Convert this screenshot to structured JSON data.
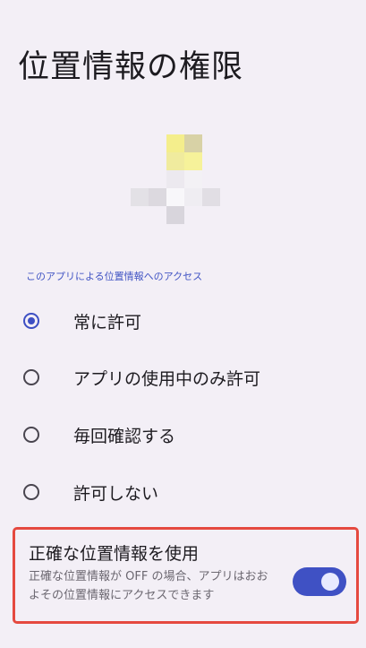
{
  "header": {
    "title": "位置情報の権限"
  },
  "app_icon": {
    "name": "app-icon-blurred"
  },
  "section": {
    "header": "このアプリによる位置情報へのアクセス"
  },
  "options": [
    {
      "label": "常に許可",
      "checked": true
    },
    {
      "label": "アプリの使用中のみ許可",
      "checked": false
    },
    {
      "label": "毎回確認する",
      "checked": false
    },
    {
      "label": "許可しない",
      "checked": false
    }
  ],
  "precise": {
    "title": "正確な位置情報を使用",
    "summary": "正確な位置情報が OFF の場合、アプリはおおよその位置情報にアクセスできます",
    "enabled": true
  },
  "colors": {
    "accent": "#3d4fc3",
    "background": "#f3eff6",
    "highlight_border": "#e5493f"
  }
}
